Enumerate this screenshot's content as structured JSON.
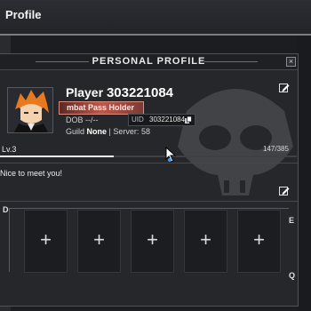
{
  "header": {
    "title": "Profile"
  },
  "panel": {
    "title": "PERSONAL PROFILE",
    "close_label": "×"
  },
  "player": {
    "name_prefix": "Player",
    "id_number": "303221084",
    "badge": "mbat Pass Holder",
    "dob_label": "DOB",
    "dob_value": "--/--",
    "uid_label": "UID",
    "uid_value": "303221084",
    "guild_label": "Guild",
    "guild_value": "None",
    "separator": "|",
    "server_label": "Server:",
    "server_value": "58"
  },
  "level": {
    "label": "Lv.3",
    "xp_text": "147/385",
    "xp_current": 147,
    "xp_max": 385
  },
  "bio": {
    "text": "Nice to meet you!"
  },
  "deck": {
    "label_left": "D",
    "label_right_top": "E",
    "label_right_bottom": "Q",
    "slots": [
      "+",
      "+",
      "+",
      "+",
      "+"
    ]
  },
  "icons": {
    "edit": "edit-icon",
    "copy": "copy-icon",
    "emblem": "skull-emblem-icon",
    "cursor": "cursor-icon"
  },
  "colors": {
    "badge": "#c0574d",
    "background": "#26272b",
    "accent_cursor": "#3aa0ff"
  }
}
